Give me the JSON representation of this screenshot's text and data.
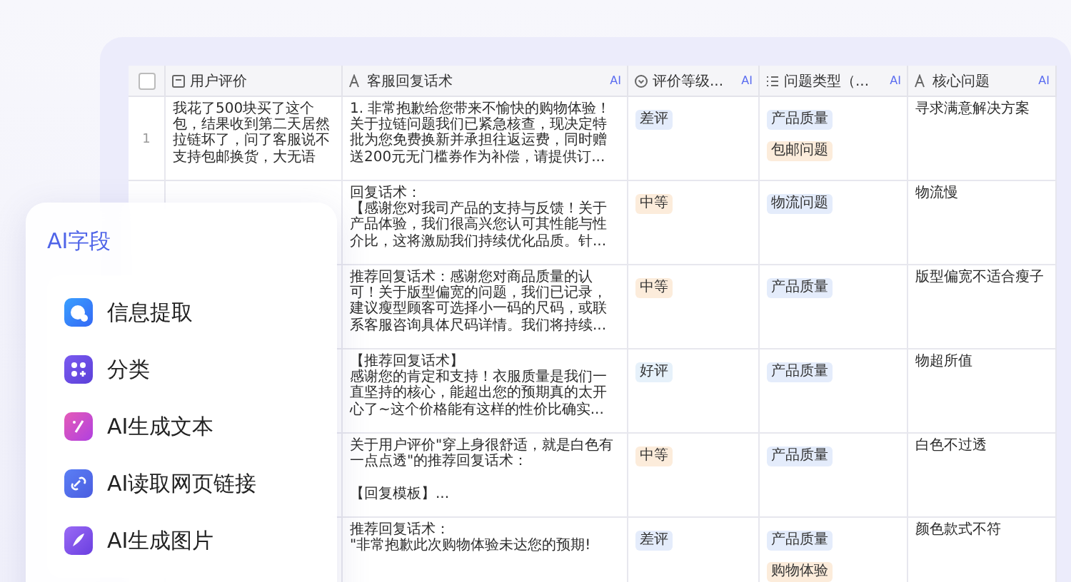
{
  "select_all": {
    "checked": false
  },
  "table": {
    "columns": [
      {
        "kind": "doc",
        "label": "用户评价"
      },
      {
        "kind": "text",
        "label": "客服回复话术",
        "badge": "AI"
      },
      {
        "kind": "select",
        "label": "评价等级...",
        "badge": "AI"
      },
      {
        "kind": "list",
        "label": "问题类型（...",
        "badge": "AI"
      },
      {
        "kind": "text",
        "label": "核心问题",
        "badge": "AI"
      }
    ],
    "rows": [
      {
        "number": "1",
        "review": "我花了500块买了这个包，结果收到第二天居然拉链坏了，问了客服说不支持包邮换货，大无语",
        "reply": [
          {
            "text": "1. 非常抱歉给您带来不愉快的购物体验！关于拉链问题我们已紧急核查，现决定特批为您免费换新并承担往返运费，同时赠送200元无门槛券作为补偿，请提供订..."
          }
        ],
        "rating": {
          "label": "差评",
          "color": "#e4ecfb"
        },
        "types": [
          {
            "label": "产品质量",
            "color": "#e4ecfb"
          },
          {
            "label": "包邮问题",
            "color": "#fcecdb"
          }
        ],
        "core": "寻求满意解决方案"
      },
      {
        "reply": [
          {
            "text": "回复话术："
          },
          {
            "text": "【感谢您对我司产品的支持与反馈！关于产品体验，我们很高兴您认可其性能与性介比，这将激励我们持续优化品质。针..."
          }
        ],
        "rating": {
          "label": "中等",
          "color": "#fcecdb"
        },
        "types": [
          {
            "label": "物流问题",
            "color": "#e4ecfb"
          }
        ],
        "core": "物流慢"
      },
      {
        "reply": [
          {
            "text": "推荐回复话术：感谢您对商品质量的认可！关于版型偏宽的问题，我们已记录，建议瘦型顾客可选择小一码的尺码，或联系客服咨询具体尺码详情。我们将持续..."
          }
        ],
        "rating": {
          "label": "中等",
          "color": "#fcecdb"
        },
        "types": [
          {
            "label": "产品质量",
            "color": "#e4ecfb"
          }
        ],
        "core": "版型偏宽不适合瘦子"
      },
      {
        "reply": [
          {
            "text": "【推荐回复话术】"
          },
          {
            "text": "感谢您的肯定和支持！衣服质量是我们一直坚持的核心，能超出您的预期真的太开心了~这个价格能有这样的性价比确实..."
          }
        ],
        "rating": {
          "label": "好评",
          "color": "#e6f1fa"
        },
        "types": [
          {
            "label": "产品质量",
            "color": "#e4ecfb"
          }
        ],
        "core": "物超所值"
      },
      {
        "reply": [
          {
            "text": "关于用户评价\"穿上身很舒适，就是白色有一点点透\"的推荐回复话术："
          },
          {
            "text": "【回复模板】...",
            "gap_before": true
          }
        ],
        "rating": {
          "label": "中等",
          "color": "#fcecdb"
        },
        "types": [
          {
            "label": "产品质量",
            "color": "#e4ecfb"
          }
        ],
        "core": "白色不过透"
      },
      {
        "reply": [
          {
            "text": "推荐回复话术："
          },
          {
            "text": "\"非常抱歉此次购物体验未达您的预期!"
          }
        ],
        "rating": {
          "label": "差评",
          "color": "#e4ecfb"
        },
        "types": [
          {
            "label": "产品质量",
            "color": "#e4ecfb"
          },
          {
            "label": "购物体验",
            "color": "#fcecdb"
          }
        ],
        "core": "颜色款式不符"
      }
    ]
  },
  "ai_panel": {
    "title": "AI字段",
    "items": [
      {
        "kind": "extract",
        "label": "信息提取"
      },
      {
        "kind": "classify",
        "label": "分类"
      },
      {
        "kind": "text",
        "label": "AI生成文本"
      },
      {
        "kind": "link",
        "label": "AI读取网页链接"
      },
      {
        "kind": "image",
        "label": "AI生成图片"
      }
    ]
  }
}
